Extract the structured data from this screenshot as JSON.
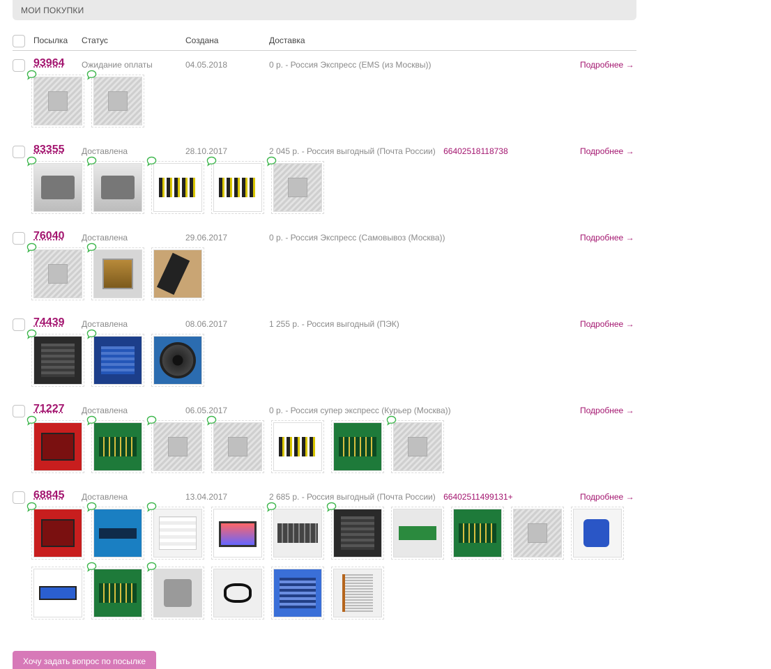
{
  "section_title": "МОИ ПОКУПКИ",
  "columns": {
    "parcel": "Посылка",
    "status": "Статус",
    "created": "Создана",
    "delivery": "Доставка"
  },
  "more_label": "Подробнее →",
  "colors": {
    "accent": "#a3156f",
    "button": "#d779b8"
  },
  "orders": [
    {
      "id": "93964",
      "status": "Ожидание оплаты",
      "date": "04.05.2018",
      "delivery": "0 р. - Россия Экспресс (EMS (из Москвы))",
      "track": "",
      "thumbs": [
        {
          "kind": "gray",
          "comment": true
        },
        {
          "kind": "gray",
          "comment": true
        }
      ]
    },
    {
      "id": "83355",
      "status": "Доставлена",
      "date": "28.10.2017",
      "delivery": "2 045 р. - Россия выгодный (Почта России)",
      "track": "66402518118738",
      "thumbs": [
        {
          "kind": "psu",
          "comment": true
        },
        {
          "kind": "psu",
          "comment": true
        },
        {
          "kind": "cable",
          "comment": true
        },
        {
          "kind": "cable",
          "comment": true
        },
        {
          "kind": "gray",
          "comment": true
        }
      ]
    },
    {
      "id": "76040",
      "status": "Доставлена",
      "date": "29.06.2017",
      "delivery": "0 р. - Россия Экспресс (Самовывоз (Москва))",
      "track": "",
      "thumbs": [
        {
          "kind": "gray",
          "comment": true
        },
        {
          "kind": "cpu",
          "comment": true
        },
        {
          "kind": "tan",
          "comment": false
        }
      ]
    },
    {
      "id": "74439",
      "status": "Доставлена",
      "date": "08.06.2017",
      "delivery": "1 255 р. - Россия выгодный (ПЭК)",
      "track": "",
      "thumbs": [
        {
          "kind": "mobo",
          "comment": true
        },
        {
          "kind": "blue",
          "comment": true
        },
        {
          "kind": "fan",
          "comment": false
        }
      ]
    },
    {
      "id": "71227",
      "status": "Доставлена",
      "date": "06.05.2017",
      "delivery": "0 р. - Россия супер экспресс (Курьер (Москва))",
      "track": "",
      "thumbs": [
        {
          "kind": "red",
          "comment": true
        },
        {
          "kind": "green",
          "comment": true
        },
        {
          "kind": "gray",
          "comment": true
        },
        {
          "kind": "gray",
          "comment": true
        },
        {
          "kind": "cable",
          "comment": false
        },
        {
          "kind": "green",
          "comment": false
        },
        {
          "kind": "gray",
          "comment": true
        }
      ]
    },
    {
      "id": "68845",
      "status": "Доставлена",
      "date": "13.04.2017",
      "delivery": "2 685 р. - Россия выгодный (Почта России)",
      "track": "66402511499131+",
      "thumbs": [
        {
          "kind": "red",
          "comment": true
        },
        {
          "kind": "ssd",
          "comment": true
        },
        {
          "kind": "white",
          "comment": true
        },
        {
          "kind": "rig",
          "comment": false
        },
        {
          "kind": "ram",
          "comment": true
        },
        {
          "kind": "mobo",
          "comment": true
        },
        {
          "kind": "nvme",
          "comment": false
        },
        {
          "kind": "green",
          "comment": false
        },
        {
          "kind": "gray",
          "comment": false
        },
        {
          "kind": "glue",
          "comment": false
        },
        {
          "kind": "riser",
          "comment": false
        },
        {
          "kind": "green",
          "comment": true
        },
        {
          "kind": "psu2",
          "comment": true
        },
        {
          "kind": "molex",
          "comment": false
        },
        {
          "kind": "bluemobo",
          "comment": false
        },
        {
          "kind": "cooler",
          "comment": false
        }
      ]
    }
  ],
  "ask_button": "Хочу задать вопрос по посылке"
}
